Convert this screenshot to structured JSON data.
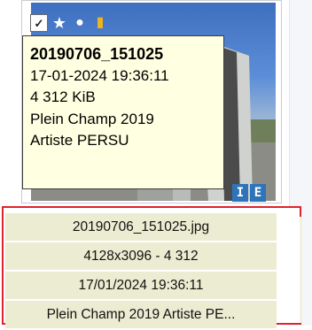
{
  "thumbnail": {
    "badges": {
      "check": "✓",
      "star": "★",
      "circle": "●",
      "tag": "▮"
    },
    "info_icons": [
      "I",
      "E"
    ],
    "tooltip": {
      "lines": [
        "20190706_151025",
        "17-01-2024 19:36:11",
        "4 312 KiB",
        "Plein Champ 2019",
        "Artiste PERSU"
      ]
    }
  },
  "caption": {
    "rows": [
      "20190706_151025.jpg",
      "4128x3096 - 4 312",
      "17/01/2024 19:36:11",
      "Plein Champ 2019 Artiste PE..."
    ]
  },
  "colors": {
    "tooltip_bg": "#ffffe1",
    "caption_bg": "#ececd2",
    "highlight_border": "#e0232b",
    "icon_blue": "#2f73b8"
  }
}
